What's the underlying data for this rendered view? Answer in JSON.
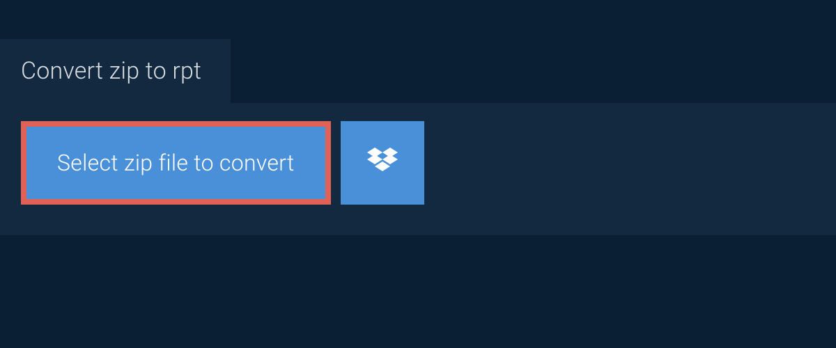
{
  "header": {
    "tab_label": "Convert zip to rpt"
  },
  "actions": {
    "select_file_label": "Select zip file to convert",
    "dropbox_icon": "dropbox-icon"
  },
  "colors": {
    "background_dark": "#0a1f33",
    "panel": "#12293f",
    "button_primary": "#4a90d9",
    "button_highlight_border": "#e06257",
    "text_light": "#d8dde2",
    "text_white": "#ffffff"
  }
}
